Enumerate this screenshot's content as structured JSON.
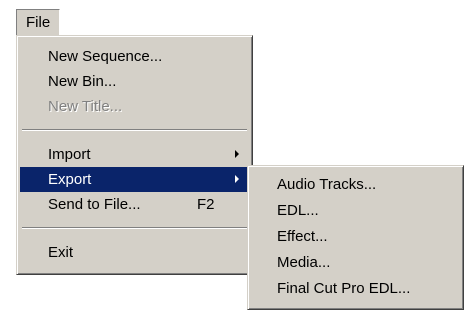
{
  "menubar": {
    "file_label": "File"
  },
  "file_menu": {
    "items": [
      {
        "label": "New Sequence..."
      },
      {
        "label": "New Bin..."
      },
      {
        "label": "New Title..."
      },
      {
        "label": "Import"
      },
      {
        "label": "Export"
      },
      {
        "label": "Send to File...",
        "shortcut": "F2"
      },
      {
        "label": "Exit"
      }
    ]
  },
  "export_submenu": {
    "items": [
      {
        "label": "Audio Tracks..."
      },
      {
        "label": "EDL..."
      },
      {
        "label": "Effect..."
      },
      {
        "label": "Media..."
      },
      {
        "label": "Final Cut Pro EDL..."
      }
    ]
  },
  "colors": {
    "menu_bg": "#d4d0c8",
    "highlight_bg": "#0a246a",
    "highlight_text": "#ffffff",
    "disabled_text": "#808080"
  }
}
